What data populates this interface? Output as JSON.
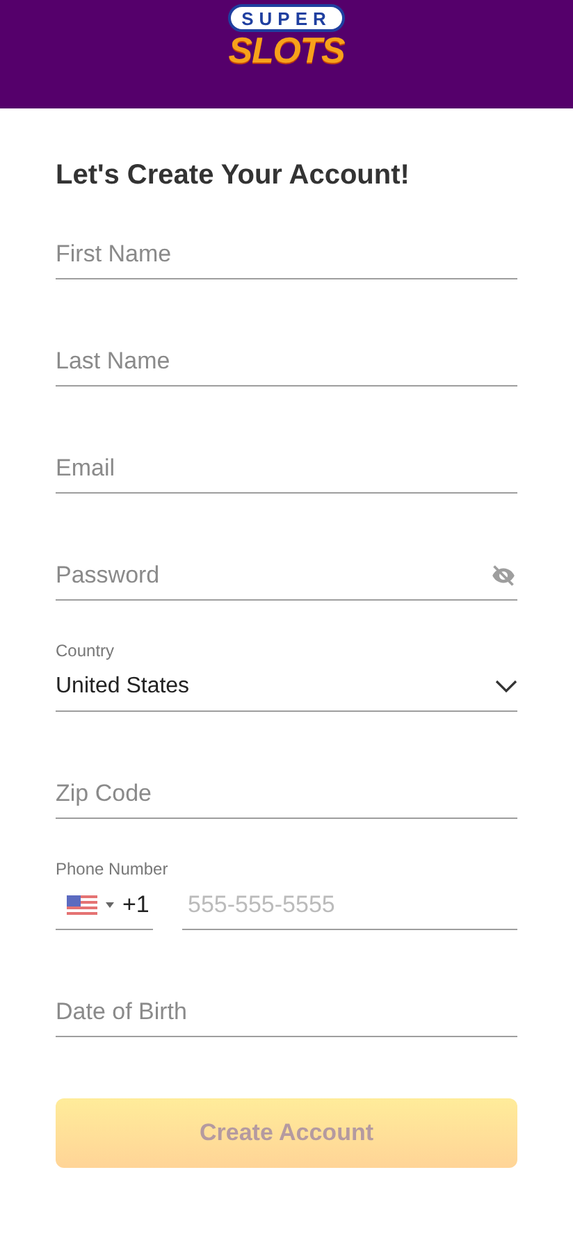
{
  "header": {
    "logo_top": "SUPER",
    "logo_bottom": "SLOTS"
  },
  "title": "Let's Create Your Account!",
  "fields": [
    {
      "kind": "text",
      "placeholder": "First Name"
    },
    {
      "kind": "text",
      "placeholder": "Last Name"
    },
    {
      "kind": "text",
      "placeholder": "Email"
    },
    {
      "kind": "password",
      "placeholder": "Password"
    },
    {
      "kind": "select",
      "label": "Country",
      "value": "United States"
    },
    {
      "kind": "text",
      "placeholder": "Zip Code"
    },
    {
      "kind": "phone",
      "label": "Phone Number",
      "code": "+1",
      "placeholder": "555-555-5555"
    },
    {
      "kind": "text",
      "placeholder": "Date of Birth"
    }
  ],
  "submit": {
    "label": "Create Account",
    "disabled": true
  }
}
